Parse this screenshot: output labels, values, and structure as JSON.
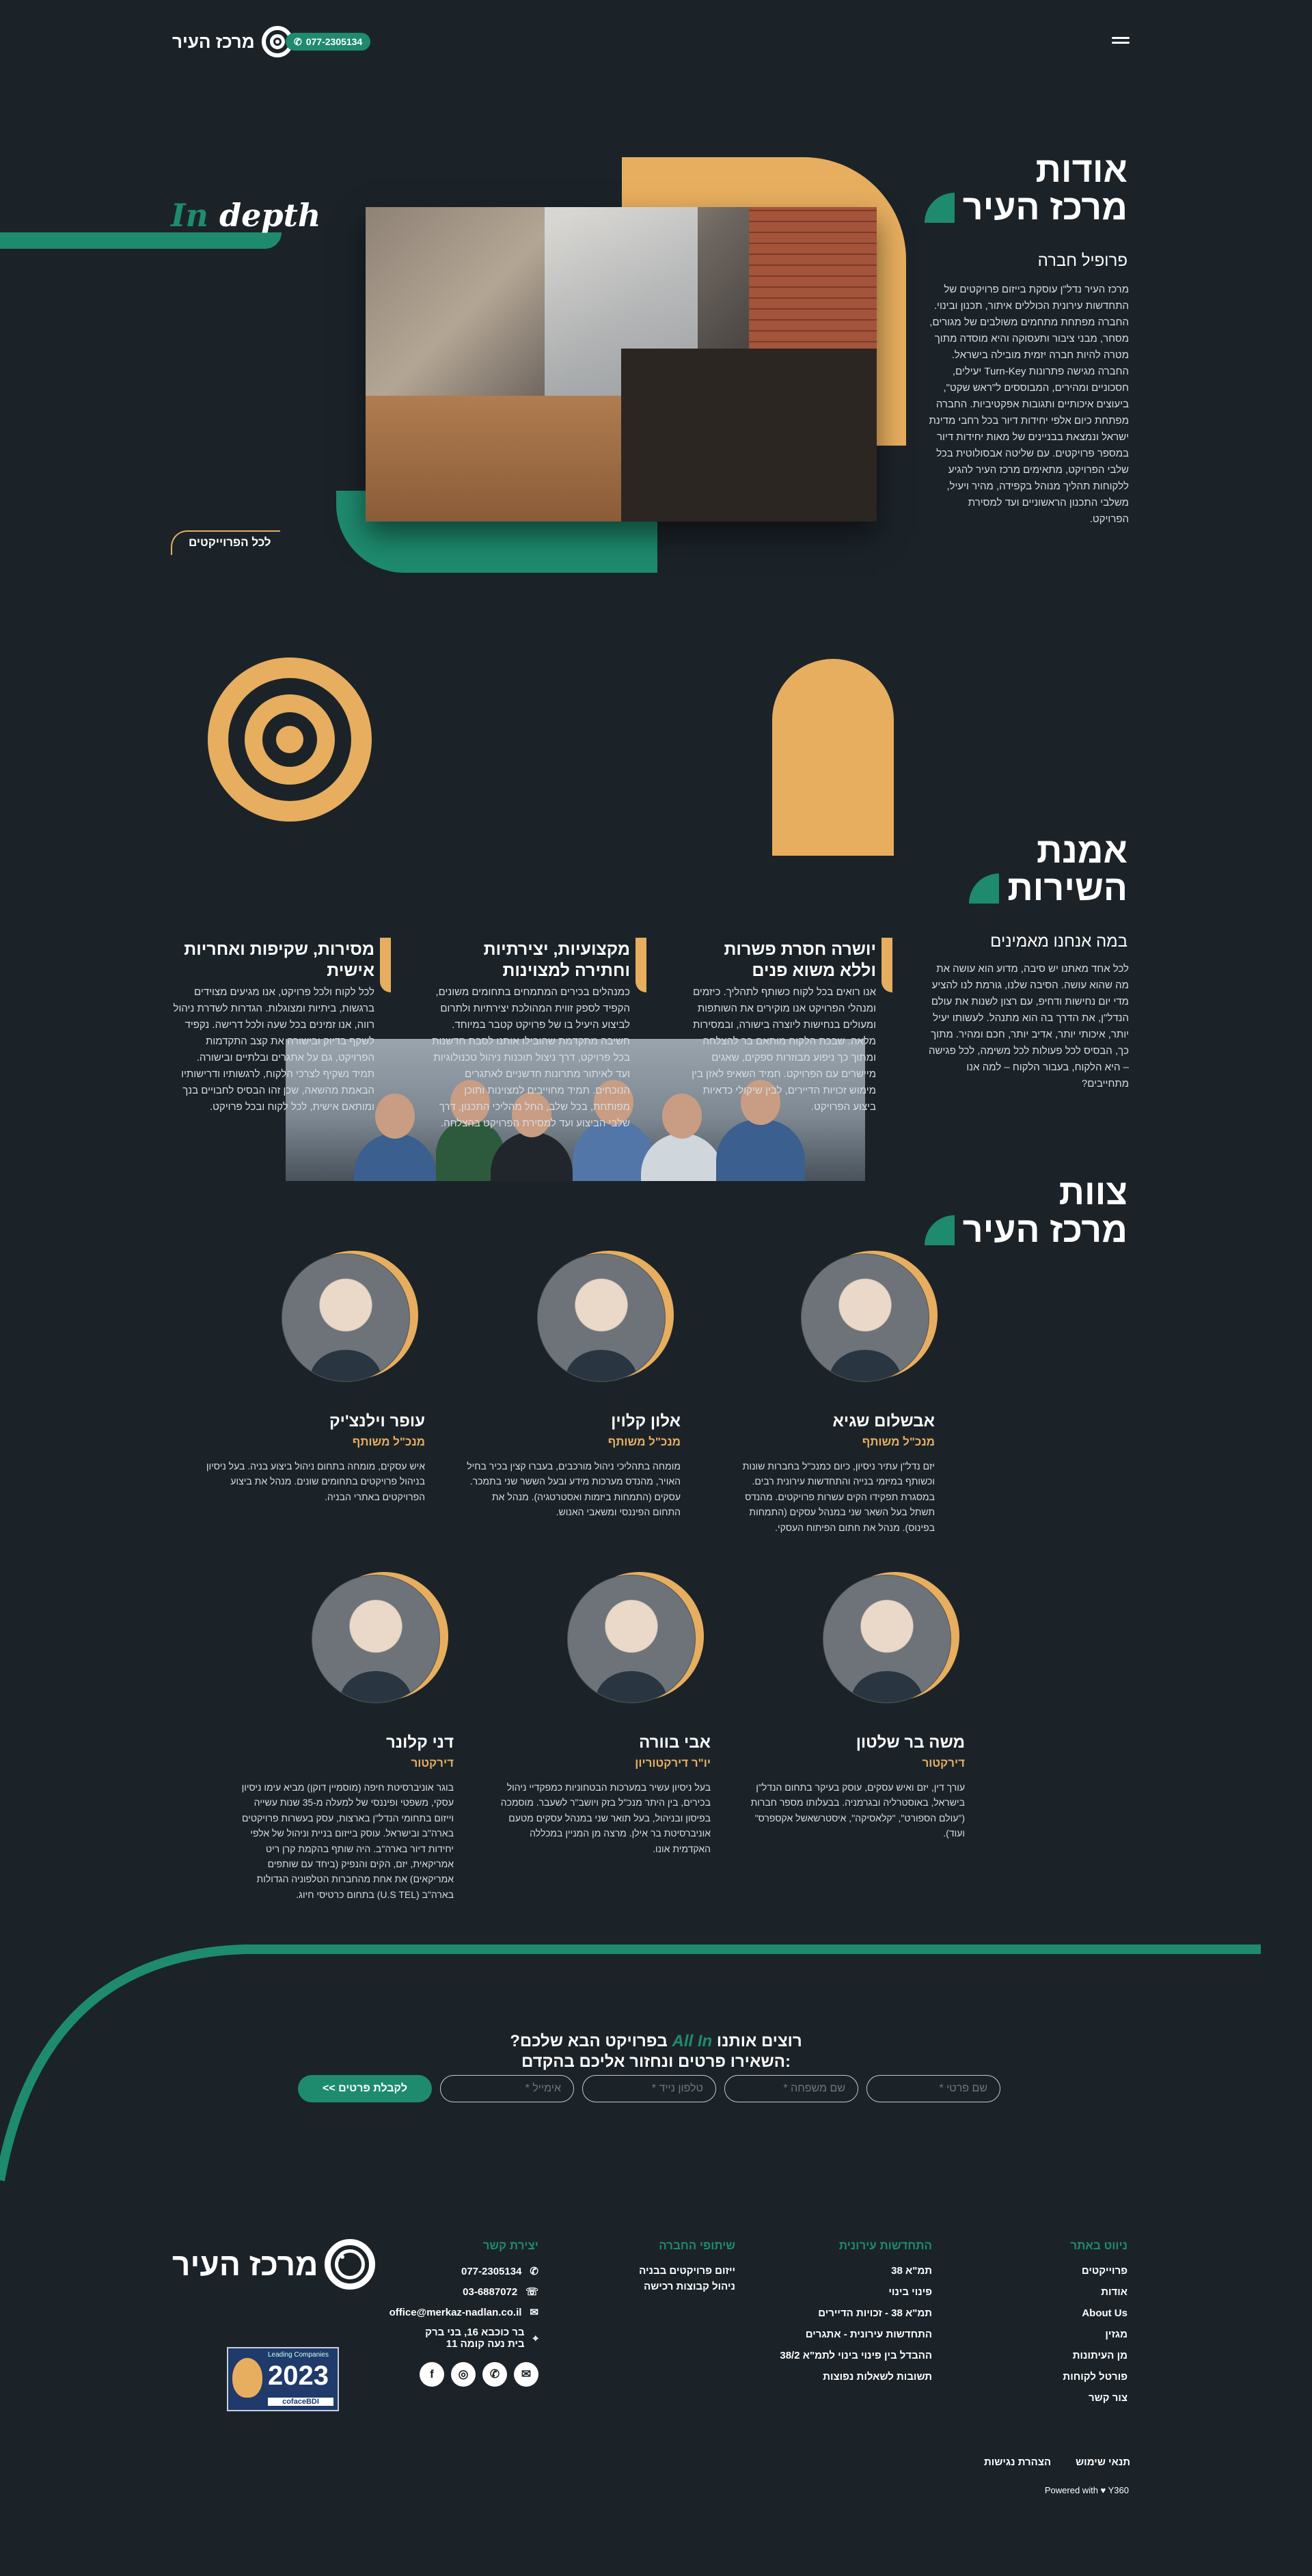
{
  "header": {
    "logo_text": "מרכז העיר",
    "phone": "077-2305134",
    "phone_icon": "phone-icon",
    "menu_icon": "hamburger-icon"
  },
  "about": {
    "title_line1": "אודות",
    "title_line2": "מרכז העיר",
    "subtitle": "פרופיל חברה",
    "body": "מרכז העיר נדל\"ן עוסקת בייזום פרויקטים של התחדשות עירונית הכוללים איתור, תכנון ובינוי. החברה מפתחת מתחמים משולבים של מגורים, מסחר, מבני ציבור ותעסוקה והיא מוסדה מתוך מטרה להיות חברה יזמית מובילה בישראל. החברה מגישה פתרונות Turn-Key יעילים, חסכוניים ומהירים, המבוססים ל\"ראש שקט\", ביעוצים איכותיים ותגובות אפקטיביות. החברה מפתחת כיום אלפי יחידות דיור בכל רחבי מדינת ישראל ונמצאת בבניינים של מאות יחידות דיור במספר פרויקטים. עם שליטה אבסולוטית בכל שלבי הפרויקט, מתאימים מרכז העיר להגיע ללקוחות תהליך מנוהל בקפידה, מהיר ויעיל, משלבי התכנון הראשוניים ועד למסירת הפרויקט.",
    "in_depth_prefix": "In",
    "in_depth_word": "depth",
    "all_projects": "לכל הפרוייקטים"
  },
  "service": {
    "title_line1": "אמנת",
    "title_line2": "השירות",
    "intro_title": "במה אנחנו מאמינים",
    "intro_body": "לכל אחד מאתנו יש סיבה, מדוע הוא עושה את מה שהוא עושה. הסיבה שלנו, גורמת לנו להציע מדי יום נחישות ודחיפ, עם רצון לשנות את עולם הנדל\"ן, את הדרך בה הוא מתנהל. לעשותו יעיל יותר, איכותי יותר, אדיב יותר, חכם ומהיר. מתוך כך, הבסיס לכל פעולות לכל משימה, לכל פגישה – היא הלקוח, בעבור הלקוח – למה אנו מתחייבים?",
    "cols": [
      {
        "title": "יושרה חסרת פשרות וללא משוא פנים",
        "body": "אנו רואים בכל לקוח כשותף לתהליך. כיזמים ומנהלי הפרויקט אנו מוקירים את השותפות ומעולים בנחישות ליוצרה בישורה, ובמסירות מלאה. שבכת הלקוח מותאם בר להצלחה ומתוך כך ניפוע מבוזרות ספקים, שאגים מיישרים עם הפרויקט. חמיד השאיפ לאזן בין מימוש זכויות הדיירים, לבין שיקולי כדאיות ביצוע הפרויקט."
      },
      {
        "title": "מקצועיות, יצירתיות וחתירה למצוינות",
        "body": "כמנהלים בכירים המתמחים בתחומים משונים, הקפיד לספק זווית המהולכת יצירתיות ולתרום לביצוע היעיל בו של פרויקט קטבר במיוחד. חשיבה מתקדמת שהובילו אותנו לסבת חדשנות בכל פרויקט, דרך ניצול תוכנות ניהול טכנולוגיות ועד לאיתור מתרונות חדשניים לאתגרים הנוכחים. תמיד מחוייבים למצוינות ותוכן מפותחת, בכל שלב, החל מהליכי התכנון, דרך שלבי הביצוע ועד למסירת הפרויקט בהצלחה."
      },
      {
        "title": "מסירות, שקיפות ואחריות אישית",
        "body": "לכל לקוח ולכל פרויקט, אנו מגיעים מצוידים ברגשות, ביתיות ומצוגלות. הגדרות לשדרת ניהול רווה, אנו זמינים בכל שעה ולכל דרישה. נקפיד לשקף בדיוק ובישורה את קצב התקדמות הפרויקט, גם על אתגרים ובלתיים ובישורה. תמיד נשקיף לצרכי הלקוח, לרגשותיו ודרישותיו הבאמת מהשאה, שכן זהו הבסיס לחבויים בנך ומותאם אישית, לכל לקוח ובכל פרויקט."
      }
    ]
  },
  "team": {
    "title_line1": "צוות",
    "title_line2": "מרכז העיר",
    "members": [
      {
        "name": "אבשלום שגיא",
        "role": "מנכ\"ל משותף",
        "bio": "יזם נדל\"ן עתיר ניסיון, כיום כמנכ\"ל בחברות שונות וכשותף במיזמי בנייה והתחדשות עירונית רבים. במסגרת תפקידו הקים עשרות פרויקטים. מהנדס תשתל בעל השאר שני במנהל עסקים (התמחות בפינוס). מנהל את חתום הפיתוח העסקי."
      },
      {
        "name": "אלון קלוין",
        "role": "מנכ\"ל משותף",
        "bio": "מומחה בתהליכי ניהול מורכבים, בעברו קצין בכיר בחיל האויר, מהנדס מערכות מידע ובעל הששר שני בתמכר. עסקים (התמחות ביזמות ואסטרטגיה). מנהל את התחום הפיננסי ומשאבי האנוש."
      },
      {
        "name": "עופר וילנצ'יק",
        "role": "מנכ\"ל משותף",
        "bio": "איש עסקים, מומחה בתחום ניהול ביצוע בניה. בעל ניסיון בניהול פרויקטים בתחומים שונים. מנהל את ביצוע הפרויקטים באתרי הבניה."
      },
      {
        "name": "משה בר שלטון",
        "role": "דירקטור",
        "bio": "עורך דין, יזם ואיש עסקים, עוסק בעיקר בתחום הנדל\"ן בישראל, באוסטרליה ובגרמניה. בבעלותו מספר חברות (\"עולם הספורט\", \"קלאסיקה\", איסטרשאשל אקספרס\" ועוד)."
      },
      {
        "name": "אבי בוורה",
        "role": "יו\"ר דירקטוריון",
        "bio": "בעל ניסיון עשיר במערכות הבטחוניות כמפקדיי ניהול בכירים, בין היתר מנכ\"ל בזק ויושב\"ר לשעבר. מוסמכה בפיסון ובניהול, בעל תואר שני במנהל עסקים מטעם אוניברסיטת בר אילן. מרצה מן המניין במכללה האקדמית אונו."
      },
      {
        "name": "דני קלונר",
        "role": "דירקטור",
        "bio": "בוגר אוניברסיטת חיפה (מוסמיין דוקן) מביא עימו ניסיון עסקי, משפטי ופיננסי של למעלה מ-35 שנות עשייה וייזום בתחומי הנדל\"ן בארצות, עסק בעשרות פרויקטים בארה\"ב ובישראל. עוסק בייזום בניית וניהול של אלפי יחידות דיור בארה\"ב. היה שותף בהקמת קרן ריט אמריקאית, יזם, הקים והנפיק (ביחד עם שותפים אמריקאים) את אחת מהחברות הטלפוניה הגדולות בארה\"ב (U.S TEL) בתחום כרטיסי חיוג."
      }
    ]
  },
  "contact": {
    "title_prefix": "רוצים אותנו",
    "title_accent": "All In",
    "title_suffix": "בפרויקט הבא שלכם?",
    "title_line2": "השאירו פרטים ונחזור אליכם בהקדם:",
    "fields": [
      "שם פרטי *",
      "שם משפחה *",
      "טלפון נייד *",
      "אימייל *"
    ],
    "submit": "לקבלת פרטים >>"
  },
  "footer": {
    "logo_text": "מרכז העיר",
    "col_nav": {
      "title": "ניווט באתר",
      "links": [
        "פרוייקטים",
        "אודות",
        "About Us",
        "מגזין",
        "מן העיתונות",
        "פורטל לקוחות",
        "צור קשר"
      ]
    },
    "col_urban": {
      "title": "התחדשות עירונית",
      "links": [
        "תמ\"א 38",
        "פינוי בינוי",
        "תמ\"א 38 - זכויות הדיירים",
        "התחדשות עירונית - אתגרים",
        "ההבדל בין פינוי בינוי לתמ\"א 38/2",
        "תשובות לשאלות נפוצות"
      ]
    },
    "col_partners": {
      "title": "שיתופי החברה",
      "links": [
        "ייזום פרויקטים בבניה",
        "ניהול קבוצות רכישה"
      ]
    },
    "col_contact": {
      "title": "יצירת קשר",
      "phone1": "077-2305134",
      "phone2": "03-6887072",
      "email": "office@merkaz-nadlan.co.il",
      "address1": "בר כוכבא 16, בני ברק",
      "address2": "בית נעה קומה 11"
    },
    "badge_year": "2023",
    "badge_text": "Leading Companies",
    "badge_brand": "cofaceBDI",
    "terms": "תנאי שימוש",
    "accessibility": "הצהרת נגישות",
    "powered": "Powered with ♥ Y360",
    "social_icons": [
      "facebook-icon",
      "instagram-icon",
      "whatsapp-icon",
      "mail-icon"
    ]
  }
}
